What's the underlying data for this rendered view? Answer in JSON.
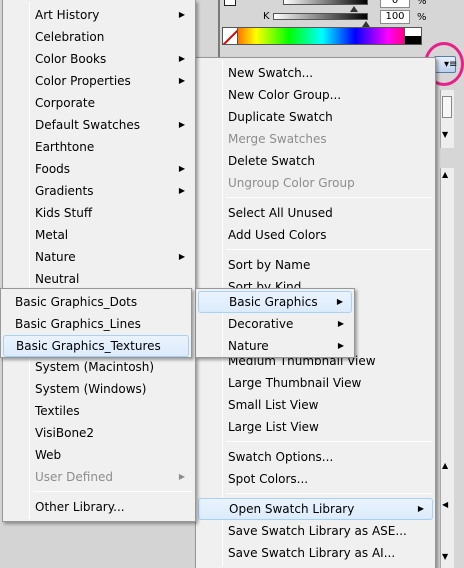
{
  "panel": {
    "k_label": "K",
    "top_value": "0",
    "k_value": "100",
    "percent": "%",
    "menu_button_icon": "panel-menu-icon",
    "accent_circle_color": "#e8208a",
    "bottom_tab_fragments": [
      "...",
      "..."
    ]
  },
  "left_menu": {
    "items": [
      {
        "label": "Art History",
        "submenu": true,
        "disabled": false
      },
      {
        "label": "Celebration",
        "submenu": false,
        "disabled": false
      },
      {
        "label": "Color Books",
        "submenu": true,
        "disabled": false
      },
      {
        "label": "Color Properties",
        "submenu": true,
        "disabled": false
      },
      {
        "label": "Corporate",
        "submenu": false,
        "disabled": false
      },
      {
        "label": "Default Swatches",
        "submenu": true,
        "disabled": false
      },
      {
        "label": "Earthtone",
        "submenu": false,
        "disabled": false
      },
      {
        "label": "Foods",
        "submenu": true,
        "disabled": false
      },
      {
        "label": "Gradients",
        "submenu": true,
        "disabled": false
      },
      {
        "label": "Kids Stuff",
        "submenu": false,
        "disabled": false
      },
      {
        "label": "Metal",
        "submenu": false,
        "disabled": false
      },
      {
        "label": "Nature",
        "submenu": true,
        "disabled": false
      },
      {
        "label": "Neutral",
        "submenu": false,
        "disabled": false
      },
      {
        "label": "System (Macintosh)",
        "submenu": false,
        "disabled": false
      },
      {
        "label": "System (Windows)",
        "submenu": false,
        "disabled": false
      },
      {
        "label": "Textiles",
        "submenu": false,
        "disabled": false
      },
      {
        "label": "VisiBone2",
        "submenu": false,
        "disabled": false
      },
      {
        "label": "Web",
        "submenu": false,
        "disabled": false
      },
      {
        "label": "User Defined",
        "submenu": true,
        "disabled": true
      },
      {
        "label": "Other Library...",
        "submenu": false,
        "disabled": false
      }
    ]
  },
  "basic_graphics_menu": {
    "items": [
      {
        "label": "Basic Graphics_Dots"
      },
      {
        "label": "Basic Graphics_Lines"
      },
      {
        "label": "Basic Graphics_Textures",
        "highlighted": true
      }
    ]
  },
  "sub_menu": {
    "items": [
      {
        "label": "Basic Graphics",
        "submenu": true,
        "highlighted": true
      },
      {
        "label": "Decorative",
        "submenu": true
      },
      {
        "label": "Nature",
        "submenu": true
      }
    ]
  },
  "right_menu": {
    "items": [
      {
        "label": "New Swatch...",
        "disabled": false
      },
      {
        "label": "New Color Group...",
        "disabled": false
      },
      {
        "label": "Duplicate Swatch",
        "disabled": false
      },
      {
        "label": "Merge Swatches",
        "disabled": true
      },
      {
        "label": "Delete Swatch",
        "disabled": false
      },
      {
        "label": "Ungroup Color Group",
        "disabled": true
      },
      {
        "label": "Select All Unused",
        "disabled": false
      },
      {
        "label": "Add Used Colors",
        "disabled": false
      },
      {
        "label": "Sort by Name",
        "disabled": false
      },
      {
        "label": "Sort by Kind",
        "disabled": false
      },
      {
        "label": "Medium Thumbnail View",
        "disabled": false
      },
      {
        "label": "Large Thumbnail View",
        "disabled": false
      },
      {
        "label": "Small List View",
        "disabled": false
      },
      {
        "label": "Large List View",
        "disabled": false
      },
      {
        "label": "Swatch Options...",
        "disabled": false
      },
      {
        "label": "Spot Colors...",
        "disabled": false
      },
      {
        "label": "Open Swatch Library",
        "disabled": false,
        "submenu": true,
        "highlighted": true
      },
      {
        "label": "Save Swatch Library as ASE...",
        "disabled": false
      },
      {
        "label": "Save Swatch Library as AI...",
        "disabled": false
      }
    ]
  },
  "arrow_glyph": "▶"
}
